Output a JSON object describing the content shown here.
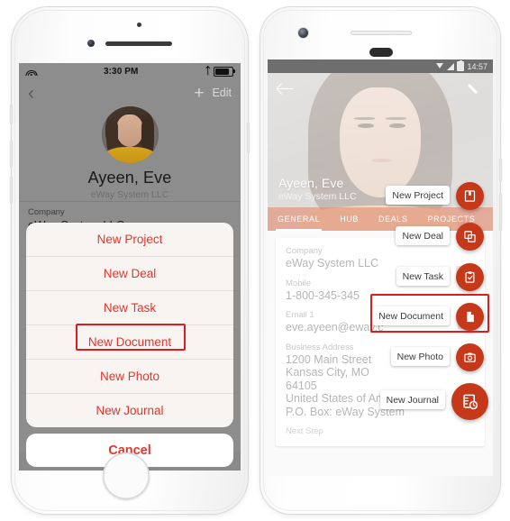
{
  "ios": {
    "status": {
      "time": "3:30 PM",
      "wifi_icon": "wifi-icon",
      "bluetooth_icon": "bluetooth-icon",
      "battery_icon": "battery-icon"
    },
    "nav": {
      "back_icon": "back-chevron-icon",
      "add_label": "+",
      "edit_label": "Edit"
    },
    "contact": {
      "name": "Ayeen, Eve",
      "company": "eWay System LLC"
    },
    "fields": [
      {
        "label": "Company",
        "value": "eWay System LLC"
      }
    ],
    "action_sheet": {
      "items": [
        "New Project",
        "New Deal",
        "New Task",
        "New Document",
        "New Photo",
        "New Journal"
      ],
      "highlighted": "New Document",
      "cancel_label": "Cancel"
    },
    "tabs": [
      "General",
      "HUB",
      "Projects",
      "Deals"
    ]
  },
  "android": {
    "status": {
      "time": "14:57",
      "wifi_icon": "wifi-icon",
      "signal_icon": "signal-icon",
      "battery_icon": "battery-icon"
    },
    "topbar": {
      "back_icon": "back-arrow-icon",
      "edit_icon": "pencil-icon"
    },
    "contact": {
      "name": "Ayeen, Eve",
      "company": "eWay System LLC"
    },
    "tabs": [
      {
        "label": "GENERAL",
        "active": true
      },
      {
        "label": "HUB",
        "active": false
      },
      {
        "label": "DEALS",
        "active": false
      },
      {
        "label": "PROJECTS",
        "active": false
      }
    ],
    "fields": [
      {
        "label": "Company",
        "value": "eWay System LLC"
      },
      {
        "label": "Mobile",
        "value": "1-800-345-345"
      },
      {
        "label": "Email 1",
        "value": "eve.ayeen@eway.c"
      },
      {
        "label": "Business Address",
        "value": "1200 Main Street\nKansas City, MO\n64105\nUnited States of America\nP.O. Box: eWay System"
      },
      {
        "label": "Next Step",
        "value": ""
      }
    ],
    "fab_menu": [
      {
        "label": "New Project",
        "icon": "book-icon"
      },
      {
        "label": "New Deal",
        "icon": "copy-icon"
      },
      {
        "label": "New Task",
        "icon": "clipboard-check-icon"
      },
      {
        "label": "New Document",
        "icon": "document-icon"
      },
      {
        "label": "New Photo",
        "icon": "camera-icon"
      },
      {
        "label": "New Journal",
        "icon": "journal-clock-icon"
      }
    ],
    "highlighted": "New Document"
  },
  "colors": {
    "accent_red": "#c6381a",
    "ios_action_red": "#e8342a",
    "highlight_box": "#e01b1b",
    "tab_bar_salmon": "#e3957e"
  }
}
